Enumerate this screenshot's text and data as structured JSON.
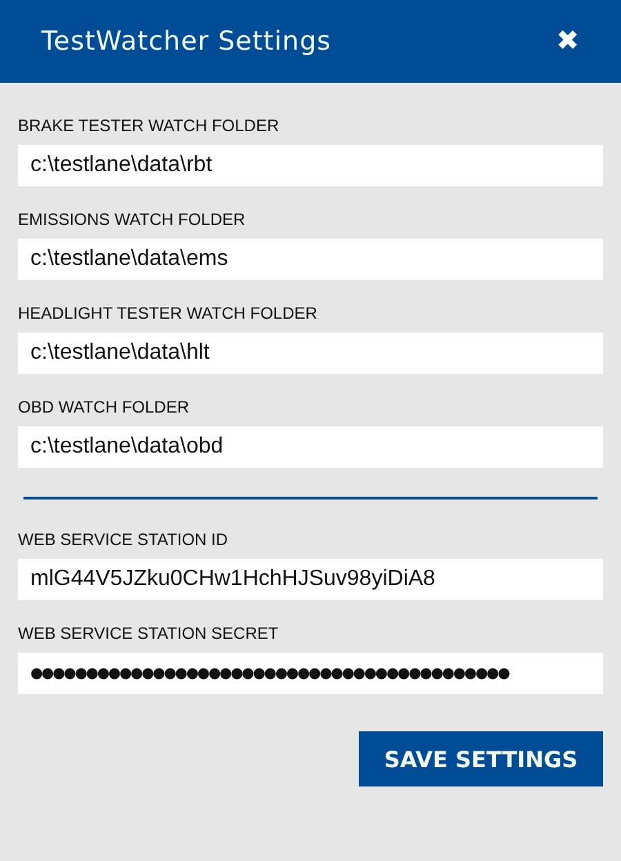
{
  "window": {
    "title": "TestWatcher Settings",
    "close": "✖"
  },
  "folder_fields": [
    {
      "label": "BRAKE TESTER WATCH FOLDER",
      "value": "c:\\testlane\\data\\rbt"
    },
    {
      "label": "EMISSIONS WATCH FOLDER",
      "value": "c:\\testlane\\data\\ems"
    },
    {
      "label": "HEADLIGHT TESTER WATCH FOLDER",
      "value": "c:\\testlane\\data\\hlt"
    },
    {
      "label": "OBD WATCH FOLDER",
      "value": "c:\\testlane\\data\\obd"
    }
  ],
  "service_fields": [
    {
      "label": "WEB SERVICE STATION ID",
      "value": "mlG44V5JZku0CHw1HchHJSuv98yiDiA8"
    },
    {
      "label": "WEB SERVICE STATION SECRET",
      "value": "●●●●●●●●●●●●●●●●●●●●●●●●●●●●●●●●●●●●●●●●●●●"
    }
  ],
  "save_button": "SAVE SETTINGS"
}
